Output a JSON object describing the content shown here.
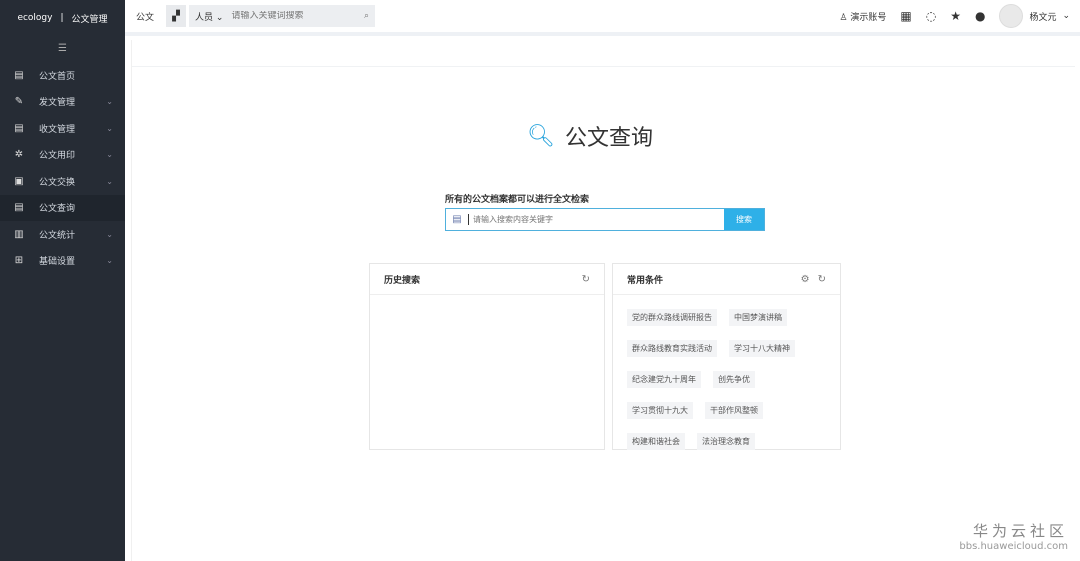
{
  "sidebar": {
    "brand": "ecology",
    "module": "公文管理",
    "collapse": "☰",
    "items": [
      {
        "label": "公文首页",
        "icon": "document-icon",
        "glyph": "▤",
        "chev": false
      },
      {
        "label": "发文管理",
        "icon": "edit-icon",
        "glyph": "✎",
        "chev": true
      },
      {
        "label": "收文管理",
        "icon": "inbox-doc-icon",
        "glyph": "▤",
        "chev": true
      },
      {
        "label": "公文用印",
        "icon": "seal-icon",
        "glyph": "✲",
        "chev": true
      },
      {
        "label": "公文交换",
        "icon": "exchange-icon",
        "glyph": "▣",
        "chev": true
      },
      {
        "label": "公文查询",
        "icon": "query-icon",
        "glyph": "▤",
        "chev": false,
        "active": true
      },
      {
        "label": "公文统计",
        "icon": "bar-chart-icon",
        "glyph": "▥",
        "chev": true
      },
      {
        "label": "基础设置",
        "icon": "settings-grid-icon",
        "glyph": "⊞",
        "chev": true
      }
    ]
  },
  "topbar": {
    "module": "公文",
    "scope": "人员",
    "placeholder": "请输入关键词搜索",
    "account": "演示账号",
    "user": "杨文元"
  },
  "main": {
    "title": "公文查询",
    "hint": "所有的公文档案都可以进行全文检索",
    "search_placeholder": "请输入搜索内容关键字",
    "search_button": "搜索",
    "history": {
      "title": "历史搜索"
    },
    "common": {
      "title": "常用条件",
      "tags": [
        "党的群众路线调研报告",
        "中国梦演讲稿",
        "群众路线教育实践活动",
        "学习十八大精神",
        "纪念建党九十周年",
        "创先争优",
        "学习贯彻十九大",
        "干部作风整顿",
        "构建和谐社会",
        "法治理念教育"
      ]
    }
  },
  "watermark": {
    "name": "华为云社区",
    "url": "bbs.huaweicloud.com"
  },
  "colors": {
    "sidebar": "#262c35",
    "accent": "#2eb0e8"
  }
}
